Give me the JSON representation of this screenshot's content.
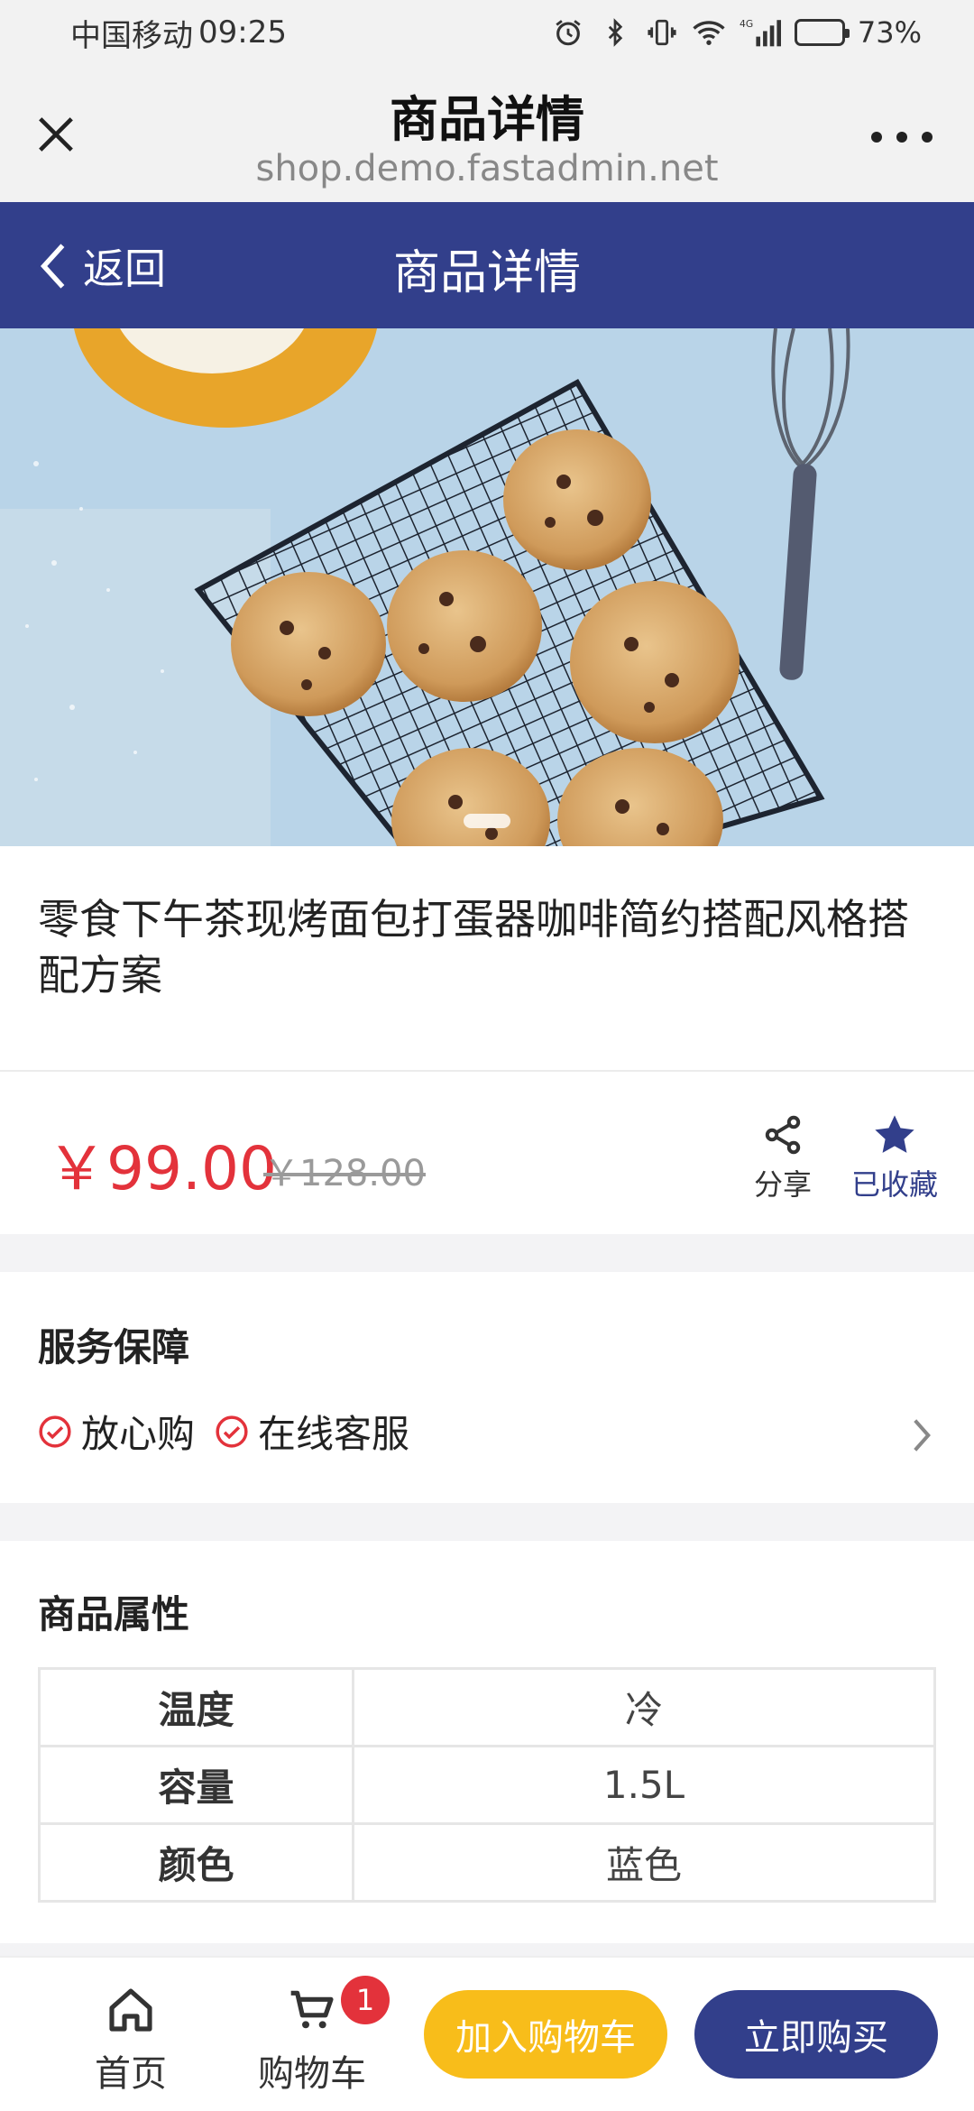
{
  "status_bar": {
    "carrier": "中国移动",
    "time": "09:25",
    "network": "4G",
    "battery_percent": "73%",
    "battery_level": 0.73
  },
  "browser": {
    "title": "商品详情",
    "url": "shop.demo.fastadmin.net"
  },
  "nav": {
    "back_label": "返回",
    "title": "商品详情"
  },
  "product": {
    "title": "零食下午茶现烤面包打蛋器咖啡简约搭配风格搭配方案",
    "price": "￥99.00",
    "original_price": "￥128.00",
    "share_label": "分享",
    "favorite_label": "已收藏"
  },
  "service": {
    "title": "服务保障",
    "items": [
      "放心购",
      "在线客服"
    ]
  },
  "attributes": {
    "title": "商品属性",
    "rows": [
      {
        "name": "温度",
        "value": "冷"
      },
      {
        "name": "容量",
        "value": "1.5L"
      },
      {
        "name": "颜色",
        "value": "蓝色"
      }
    ]
  },
  "bottom_bar": {
    "home_label": "首页",
    "cart_label": "购物车",
    "cart_count": "1",
    "add_to_cart_label": "加入购物车",
    "buy_now_label": "立即购买"
  },
  "colors": {
    "brand": "#323f8b",
    "price_red": "#e3323b",
    "add_cart_yellow": "#f8bd1a"
  }
}
